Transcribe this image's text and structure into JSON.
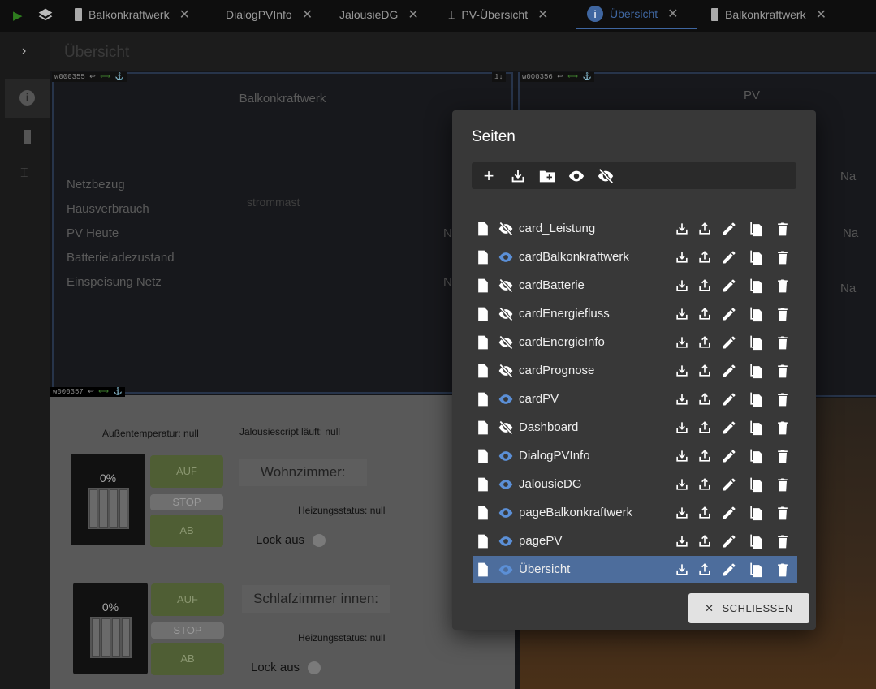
{
  "tabs": [
    {
      "label": "Balkonkraftwerk",
      "icon": "battery-charging-icon"
    },
    {
      "label": "DialogPVInfo",
      "icon": ""
    },
    {
      "label": "JalousieDG",
      "icon": ""
    },
    {
      "label": "PV-Übersicht",
      "icon": "transmission-tower-icon"
    },
    {
      "label": "Übersicht",
      "icon": "info-icon",
      "active": true
    },
    {
      "label": "Balkonkraftwerk",
      "icon": "battery-charging-icon"
    }
  ],
  "header": {
    "title": "Übersicht"
  },
  "widgets": {
    "w1": {
      "id": "w000355",
      "title": "Balkonkraftwerk",
      "image_alt": "strommast",
      "rows": [
        "Netzbezug",
        "Hausverbrauch",
        "PV Heute",
        "Batterieladezustand",
        "Einspeisung Netz"
      ],
      "partial_values": [
        "N",
        "N"
      ]
    },
    "w2": {
      "id": "w000356",
      "order": "1",
      "title": "PV",
      "partial_values": [
        "Na",
        "Na",
        "Na"
      ]
    },
    "w3": {
      "id": "w000357",
      "aussentemp": "Außentemperatur: null",
      "script": "Jalousiescript läuft: null",
      "blocks": [
        {
          "percent": "0%",
          "up": "AUF",
          "stop": "STOP",
          "down": "AB",
          "room": "Wohnzimmer:",
          "heating": "Heizungsstatus: null",
          "lock": "Lock aus"
        },
        {
          "percent": "0%",
          "up": "AUF",
          "stop": "STOP",
          "down": "AB",
          "room": "Schlafzimmer innen:",
          "heating": "Heizungsstatus: null",
          "lock": "Lock aus"
        }
      ]
    }
  },
  "dialog": {
    "title": "Seiten",
    "close_label": "SCHLIESSEN",
    "pages": [
      {
        "name": "card_Leistung",
        "visible": false
      },
      {
        "name": "cardBalkonkraftwerk",
        "visible": true
      },
      {
        "name": "cardBatterie",
        "visible": false
      },
      {
        "name": "cardEnergiefluss",
        "visible": false
      },
      {
        "name": "cardEnergieInfo",
        "visible": false
      },
      {
        "name": "cardPrognose",
        "visible": false
      },
      {
        "name": "cardPV",
        "visible": true
      },
      {
        "name": "Dashboard",
        "visible": false
      },
      {
        "name": "DialogPVInfo",
        "visible": true
      },
      {
        "name": "JalousieDG",
        "visible": true
      },
      {
        "name": "pageBalkonkraftwerk",
        "visible": true
      },
      {
        "name": "pagePV",
        "visible": true
      },
      {
        "name": "Übersicht",
        "visible": true,
        "selected": true
      }
    ]
  },
  "colors": {
    "accent": "#3f66a0",
    "selected_row": "#4d6d9c",
    "eye_visible": "#5b8fd6"
  }
}
